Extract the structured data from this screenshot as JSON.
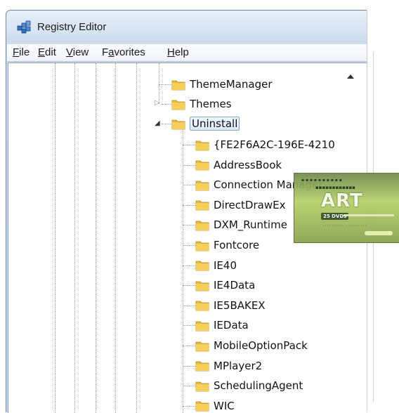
{
  "window": {
    "title": "Registry Editor"
  },
  "menu": [
    {
      "mnemonic": "F",
      "rest": "ile"
    },
    {
      "mnemonic": "E",
      "rest": "dit"
    },
    {
      "mnemonic": "V",
      "rest": "iew"
    },
    {
      "prefix": "F",
      "mnemonic": "a",
      "rest": "vorites"
    },
    {
      "mnemonic": "H",
      "rest": "elp"
    }
  ],
  "tree": {
    "parent_nodes": [
      {
        "label": "ThemeManager",
        "expander": "none"
      },
      {
        "label": "Themes",
        "expander": "collapsed"
      },
      {
        "label": "Uninstall",
        "expander": "expanded",
        "selected": true
      }
    ],
    "children": [
      "{FE2F6A2C-196E-4210",
      "AddressBook",
      "Connection Manager",
      "DirectDrawEx",
      "DXM_Runtime",
      "Fontcore",
      "IE40",
      "IE4Data",
      "IE5BAKEX",
      "IEData",
      "MobileOptionPack",
      "MPlayer2",
      "SchedulingAgent",
      "WIC"
    ]
  },
  "watermark": {
    "logo": "ART",
    "dvd_label": "25 DVDs"
  },
  "colors": {
    "folder": "#e8b83a",
    "selection_border": "#7da2ce"
  }
}
